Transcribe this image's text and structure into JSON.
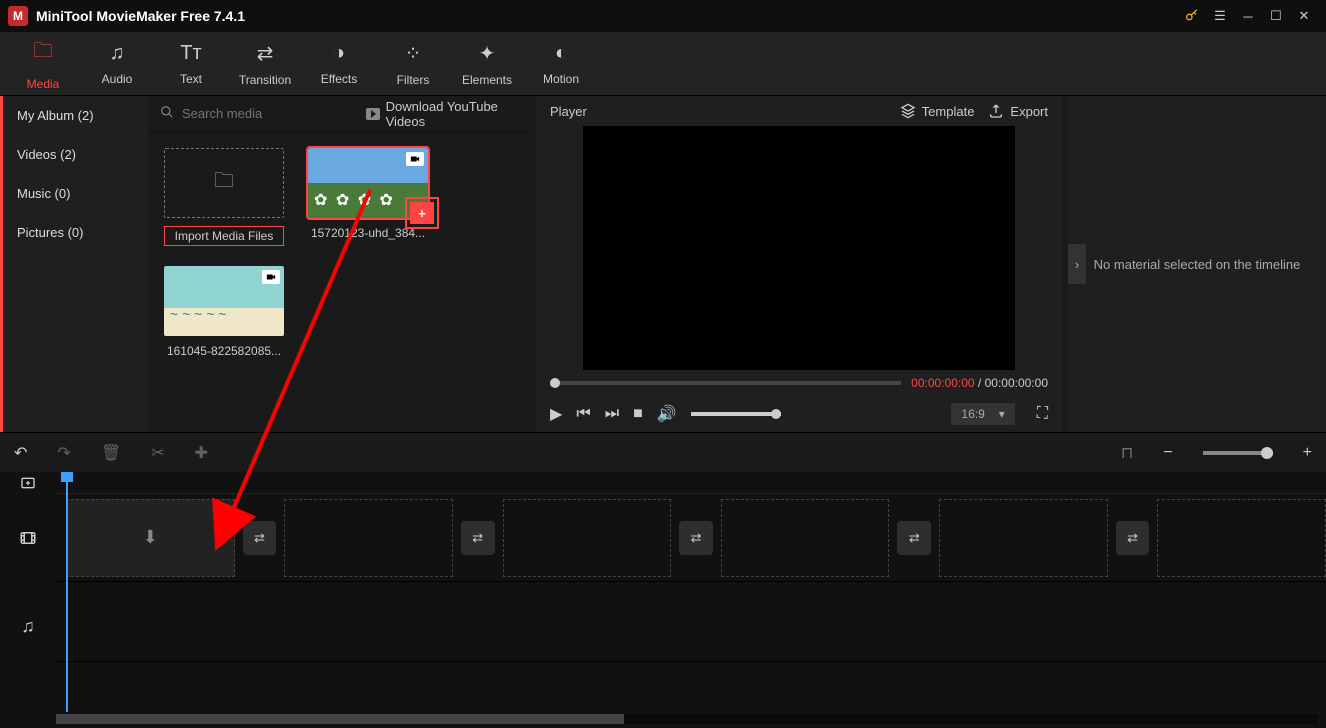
{
  "titlebar": {
    "title": "MiniTool MovieMaker Free 7.4.1"
  },
  "tabs": {
    "media": "Media",
    "audio": "Audio",
    "text": "Text",
    "transition": "Transition",
    "effects": "Effects",
    "filters": "Filters",
    "elements": "Elements",
    "motion": "Motion"
  },
  "sidebar": {
    "my_album": "My Album (2)",
    "videos": "Videos (2)",
    "music": "Music (0)",
    "pictures": "Pictures (0)"
  },
  "browser": {
    "search_placeholder": "Search media",
    "download_yt": "Download YouTube Videos",
    "import_label": "Import Media Files",
    "clip1": "15720123-uhd_384...",
    "clip2": "161045-822582085..."
  },
  "player": {
    "label": "Player",
    "template": "Template",
    "export": "Export",
    "time_current": "00:00:00:00",
    "time_sep": " / ",
    "time_total": "00:00:00:00",
    "aspect": "16:9"
  },
  "rightpanel": {
    "msg": "No material selected on the timeline"
  }
}
